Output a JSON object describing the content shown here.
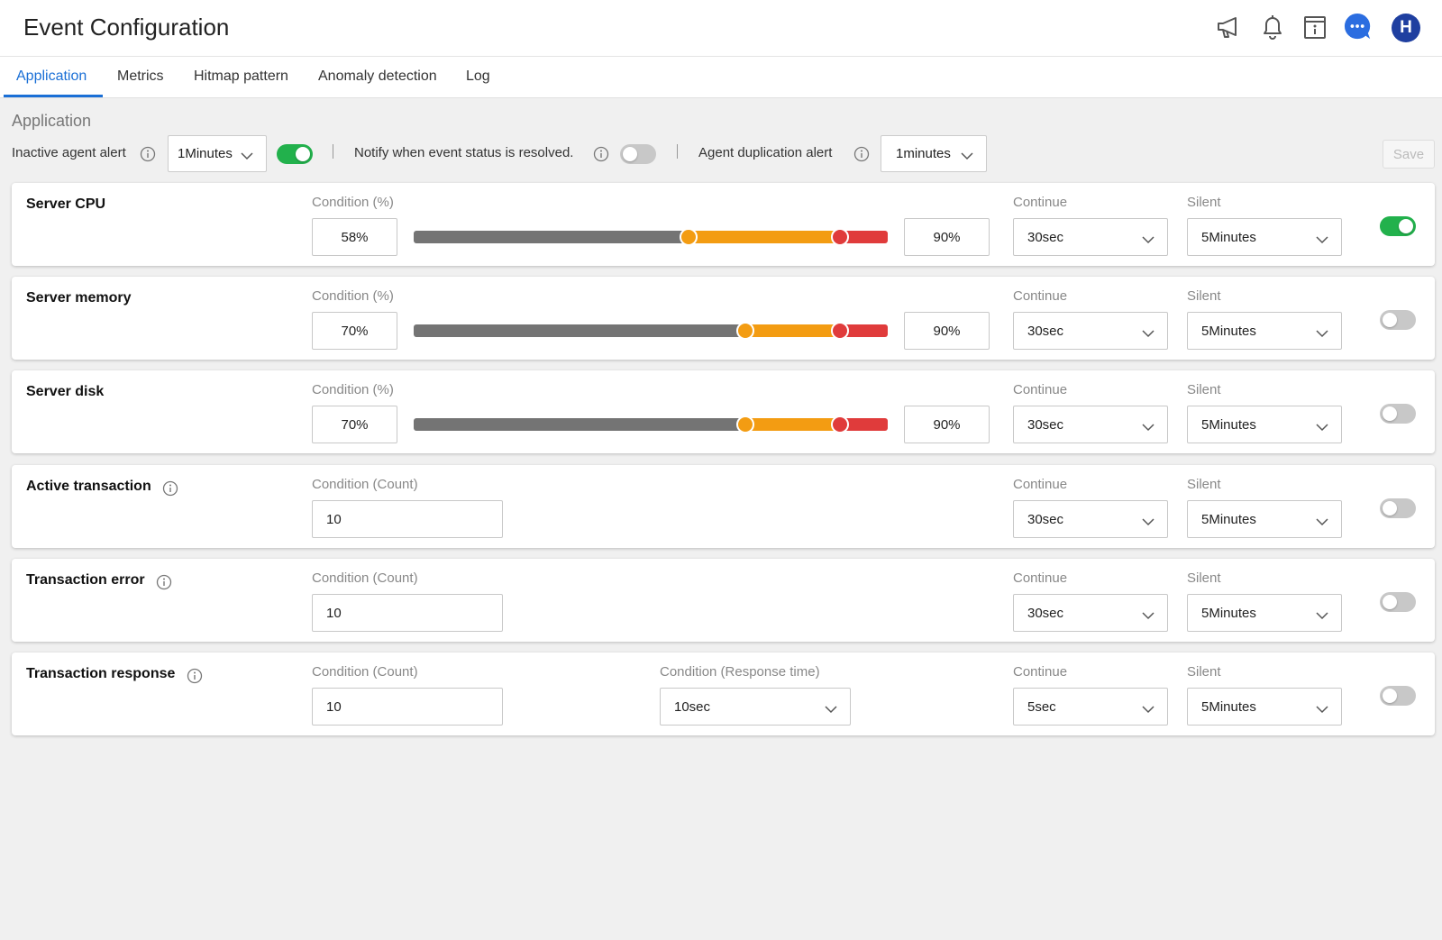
{
  "header": {
    "title": "Event Configuration",
    "avatar_letter": "H",
    "icons": [
      "megaphone-icon",
      "bell-icon",
      "info-card-icon",
      "chat-bubble-icon"
    ],
    "chat_color": "#2b6de0",
    "avatar_color": "#1f3fa0"
  },
  "tabs": [
    {
      "label": "Application",
      "active": true
    },
    {
      "label": "Metrics",
      "active": false
    },
    {
      "label": "Hitmap pattern",
      "active": false
    },
    {
      "label": "Anomaly detection",
      "active": false
    },
    {
      "label": "Log",
      "active": false
    }
  ],
  "section": {
    "title": "Application",
    "inactive_label": "Inactive agent alert",
    "inactive_value": "1Minutes",
    "inactive_enabled": true,
    "notify_label": "Notify when event status is resolved.",
    "notify_enabled": false,
    "dup_label": "Agent duplication alert",
    "dup_value": "1minutes",
    "save_label": "Save"
  },
  "labels": {
    "condition_pct": "Condition (%)",
    "condition_count": "Condition (Count)",
    "condition_response": "Condition (Response time)",
    "continue": "Continue",
    "silent": "Silent"
  },
  "colors": {
    "accent": "#1a6fd6",
    "toggle_on": "#22b14c",
    "toggle_off": "#c8c8c8",
    "slider_low": "#747474",
    "slider_warning": "#f39c12",
    "slider_critical": "#e03b3b"
  },
  "cards": [
    {
      "title": "Server CPU",
      "type": "percent",
      "info": false,
      "low": "58%",
      "high": "90%",
      "low_value": 58,
      "high_value": 90,
      "continue": "30sec",
      "silent": "5Minutes",
      "enabled": true
    },
    {
      "title": "Server memory",
      "type": "percent",
      "info": false,
      "low": "70%",
      "high": "90%",
      "low_value": 70,
      "high_value": 90,
      "continue": "30sec",
      "silent": "5Minutes",
      "enabled": false
    },
    {
      "title": "Server disk",
      "type": "percent",
      "info": false,
      "low": "70%",
      "high": "90%",
      "low_value": 70,
      "high_value": 90,
      "continue": "30sec",
      "silent": "5Minutes",
      "enabled": false
    },
    {
      "title": "Active transaction",
      "type": "count",
      "info": true,
      "count": "10",
      "continue": "30sec",
      "silent": "5Minutes",
      "enabled": false
    },
    {
      "title": "Transaction error",
      "type": "count",
      "info": true,
      "count": "10",
      "continue": "30sec",
      "silent": "5Minutes",
      "enabled": false
    },
    {
      "title": "Transaction response",
      "type": "count_response",
      "info": true,
      "count": "10",
      "response": "10sec",
      "continue": "5sec",
      "silent": "5Minutes",
      "enabled": false
    }
  ]
}
